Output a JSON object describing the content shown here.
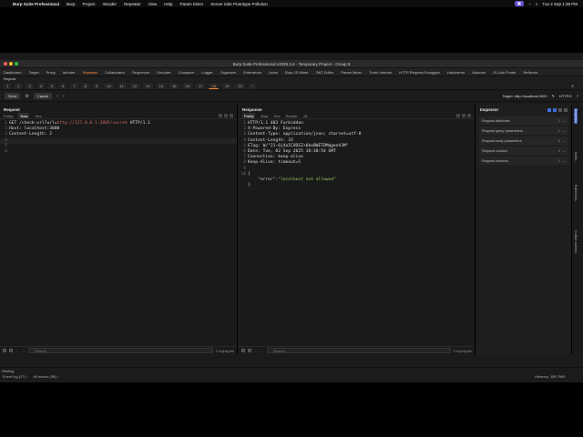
{
  "mac_menu": {
    "app": "Burp Suite Professional",
    "items": [
      "Burp",
      "Project",
      "Intruder",
      "Repeater",
      "View",
      "Help",
      "Param Miner",
      "Server Side Prototype Pollution"
    ],
    "clock": "Tue 2 Sep  1:38 PM"
  },
  "window_title": "Burp Suite Professional v2025.3.4 - Temporary Project - Group 9",
  "main_tabs": [
    "Dashboard",
    "Target",
    "Proxy",
    "Intruder",
    "Repeater",
    "Collaborator",
    "Sequencer",
    "Decoder",
    "Comparer",
    "Logger",
    "Organizer",
    "Extensions",
    "Learn",
    "Burp JS Miner",
    "JWT Editor",
    "Param Miner",
    "Turbo Intruder",
    "HTTP Request Smuggler",
    "Hackvertor",
    "Autorize",
    "JS Link Finder",
    "Reflector"
  ],
  "active_main_tab_index": 4,
  "sub_label": "Repeat",
  "request_tabs": [
    "1",
    "2",
    "3",
    "4",
    "5",
    "6",
    "7",
    "8",
    "9",
    "10",
    "11",
    "12",
    "13",
    "14",
    "15",
    "16",
    "17",
    "18",
    "19",
    "20",
    "+"
  ],
  "active_request_tab_index": 17,
  "toolbar": {
    "send": "Send",
    "cancel": "Cancel",
    "target": "Target: http://localhost:3000",
    "http": "HTTP/1"
  },
  "request": {
    "title": "Request",
    "tabs": [
      "Pretty",
      "Raw",
      "Hex"
    ],
    "active_tab": "Raw",
    "lines": [
      {
        "n": "1",
        "pre": "GET /check-url?url=",
        "url": "http://127.0.0.1:3005/secret",
        "post": " HTTP/1.1"
      },
      {
        "n": "2",
        "pre": "Host: localhost:3000",
        "url": "",
        "post": ""
      },
      {
        "n": "3",
        "pre": "Content-Length: 2",
        "url": "",
        "post": ""
      },
      {
        "n": "4",
        "pre": "",
        "url": "",
        "post": ""
      },
      {
        "n": "5",
        "pre": "",
        "url": "",
        "post": ""
      },
      {
        "n": "6",
        "pre": "",
        "url": "",
        "post": ""
      }
    ],
    "search_placeholder": "Search",
    "highlights": "0 highlights"
  },
  "response": {
    "title": "Response",
    "tabs": [
      "Pretty",
      "Raw",
      "Hex",
      "Render",
      "JS"
    ],
    "active_tab": "Pretty",
    "lines": [
      {
        "n": "1",
        "text": "HTTP/1.1 403 Forbidden"
      },
      {
        "n": "2",
        "text": "X-Powered-By: Express"
      },
      {
        "n": "3",
        "text": "Content-Type: application/json; charset=utf-8"
      },
      {
        "n": "4",
        "text": "Content-Length: 33"
      },
      {
        "n": "5",
        "text": "ETag: W/\"21-6j4oICVDEZ+6kxBWETDMqgeeh3M\""
      },
      {
        "n": "6",
        "text": "Date: Tue, 02 Sep 2025 18:38:54 GMT"
      },
      {
        "n": "7",
        "text": "Connection: keep-alive"
      },
      {
        "n": "8",
        "text": "Keep-Alive: timeout=5"
      },
      {
        "n": "9",
        "text": ""
      },
      {
        "n": "10",
        "text": "{"
      },
      {
        "n": "",
        "text": "    \"error\":\"localhost not allowed\""
      },
      {
        "n": "",
        "text": "}"
      }
    ],
    "json_key": "\"error\":",
    "json_val": "\"localhost not allowed\"",
    "search_placeholder": "Search",
    "highlights": "0 highlights"
  },
  "inspector": {
    "title": "Inspector",
    "rows": [
      {
        "label": "Request attributes",
        "count": "2"
      },
      {
        "label": "Request query parameters",
        "count": "1"
      },
      {
        "label": "Request body parameters",
        "count": "0"
      },
      {
        "label": "Request cookies",
        "count": "0"
      },
      {
        "label": "Request headers",
        "count": "2"
      }
    ]
  },
  "side_tabs": [
    "Inspector",
    "Notes",
    "Extensions",
    "Custom actions"
  ],
  "status": {
    "line1": "Waiting",
    "event_log": "Event log (27)",
    "all_issues": "All issues (38)",
    "memory": "Memory: 188.7MB"
  },
  "colors": {
    "accent": "#ff8a3d",
    "error_text": "#9ccc65",
    "url": "#d16a6a"
  }
}
